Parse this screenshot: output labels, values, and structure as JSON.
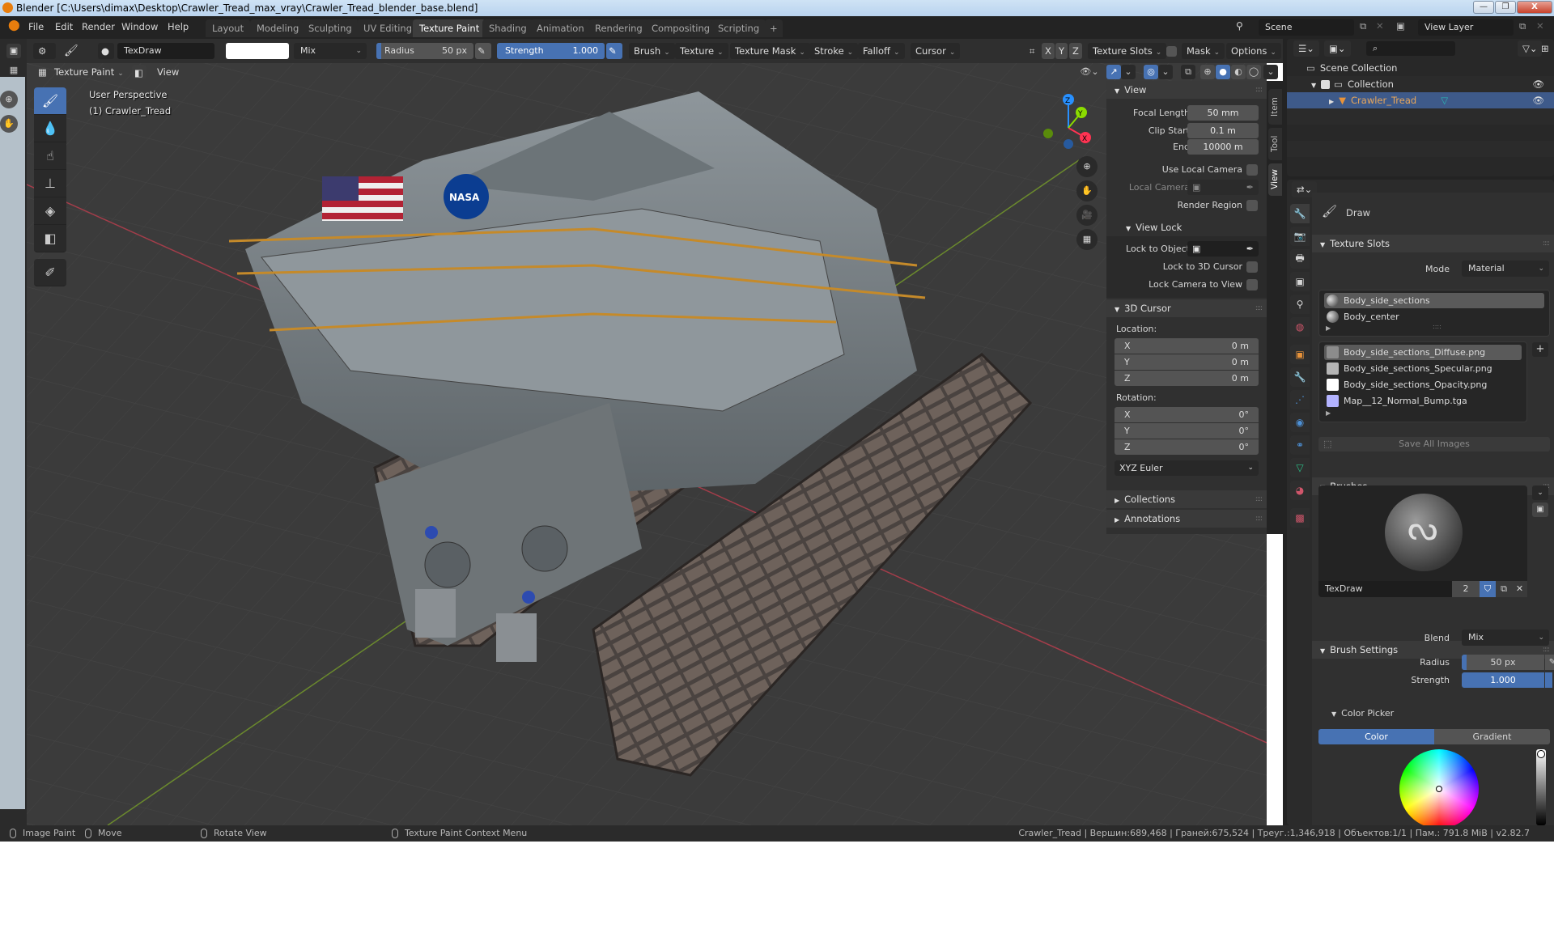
{
  "window": {
    "title": "Blender [C:\\Users\\dimax\\Desktop\\Crawler_Tread_max_vray\\Crawler_Tread_blender_base.blend]",
    "controls": {
      "minimize": "—",
      "maximize": "❐",
      "close": "X"
    }
  },
  "menubar": {
    "items": [
      "File",
      "Edit",
      "Render",
      "Window",
      "Help"
    ]
  },
  "workspaces": {
    "tabs": [
      "Layout",
      "Modeling",
      "Sculpting",
      "UV Editing",
      "Texture Paint",
      "Shading",
      "Animation",
      "Rendering",
      "Compositing",
      "Scripting"
    ],
    "active": "Texture Paint",
    "add_label": "+"
  },
  "scene": {
    "name": "Scene",
    "view_layer": "View Layer"
  },
  "tool_header": {
    "brush_name": "TexDraw",
    "color_swatch": "#ffffff",
    "blend": "Mix",
    "radius_label": "Radius",
    "radius_value": "50 px",
    "radius_fraction": 0.05,
    "strength_label": "Strength",
    "strength_value": "1.000",
    "strength_fraction": 1.0,
    "menus": [
      "Brush",
      "Texture",
      "Texture Mask",
      "Stroke",
      "Falloff",
      "Cursor"
    ],
    "axes": [
      "X",
      "Y",
      "Z"
    ],
    "texture_slots": "Texture Slots",
    "mask": "Mask",
    "options": "Options"
  },
  "viewport_header": {
    "mode": "Texture Paint",
    "view_menu": "View"
  },
  "viewport": {
    "perspective": "User Perspective",
    "object": "(1) Crawler_Tread",
    "gizmo": {
      "x": "X",
      "y": "Y",
      "z": "Z"
    },
    "colors": {
      "x_axis": "#ff3352",
      "y_axis": "#8bdc00",
      "z_axis": "#2890ff",
      "grid_x_line": "#a33d4a",
      "grid_y_line": "#6b8a2d"
    }
  },
  "tools": [
    {
      "name": "draw",
      "icon": "✎",
      "active": true
    },
    {
      "name": "soften",
      "icon": "💧"
    },
    {
      "name": "smear",
      "icon": "☝"
    },
    {
      "name": "clone",
      "icon": "⊥"
    },
    {
      "name": "fill",
      "icon": "◈"
    },
    {
      "name": "mask",
      "icon": "◧"
    },
    {
      "name": "annotate",
      "icon": "✐"
    }
  ],
  "n_panel": {
    "tabs": [
      "Item",
      "Tool",
      "View"
    ],
    "active_tab": "View",
    "view": {
      "title": "View",
      "focal_length_label": "Focal Length",
      "focal_length": "50 mm",
      "clip_start_label": "Clip Start",
      "clip_start": "0.1 m",
      "clip_end_label": "End",
      "clip_end": "10000 m",
      "use_local_camera": "Use Local Camera",
      "local_camera": "Local Camera",
      "render_region": "Render Region"
    },
    "view_lock": {
      "title": "View Lock",
      "lock_to_object": "Lock to Object",
      "lock_to_3d_cursor": "Lock to 3D Cursor",
      "lock_camera_to_view": "Lock Camera to View"
    },
    "cursor": {
      "title": "3D Cursor",
      "location_label": "Location:",
      "location": [
        {
          "axis": "X",
          "value": "0 m"
        },
        {
          "axis": "Y",
          "value": "0 m"
        },
        {
          "axis": "Z",
          "value": "0 m"
        }
      ],
      "rotation_label": "Rotation:",
      "rotation": [
        {
          "axis": "X",
          "value": "0°"
        },
        {
          "axis": "Y",
          "value": "0°"
        },
        {
          "axis": "Z",
          "value": "0°"
        }
      ],
      "rotation_mode": "XYZ Euler"
    },
    "collections": "Collections",
    "annotations": "Annotations"
  },
  "outliner": {
    "root": "Scene Collection",
    "collection": "Collection",
    "object": "Crawler_Tread"
  },
  "properties": {
    "tool_name": "Draw",
    "texture_slots": {
      "title": "Texture Slots",
      "mode_label": "Mode",
      "mode": "Material",
      "materials": [
        "Body_side_sections",
        "Body_center"
      ],
      "images": [
        {
          "name": "Body_side_sections_Diffuse.png",
          "swatch": "#8c8c8c"
        },
        {
          "name": "Body_side_sections_Specular.png",
          "swatch": "#b5b5b5"
        },
        {
          "name": "Body_side_sections_Opacity.png",
          "swatch": "#ffffff"
        },
        {
          "name": "Map__12_Normal_Bump.tga",
          "swatch": "#b3b3ff"
        }
      ],
      "save_all": "Save All Images"
    },
    "brushes": {
      "title": "Brushes",
      "brush_name": "TexDraw",
      "users": "2"
    },
    "brush_settings": {
      "title": "Brush Settings",
      "blend_label": "Blend",
      "blend": "Mix",
      "radius_label": "Radius",
      "radius": "50 px",
      "strength_label": "Strength",
      "strength": "1.000"
    },
    "color_picker": {
      "title": "Color Picker",
      "tab_color": "Color",
      "tab_gradient": "Gradient",
      "value_fraction": 1.0
    }
  },
  "statusbar": {
    "left": [
      "Image Paint",
      "Move",
      "Rotate View",
      "Texture Paint Context Menu"
    ],
    "stats": "Crawler_Tread | Вершин:689,468 | Граней:675,524 | Треуг.:1,346,918 | Объектов:1/1 | Пам.: 791.8 MiB | v2.82.7"
  },
  "accent": "#4772b3"
}
